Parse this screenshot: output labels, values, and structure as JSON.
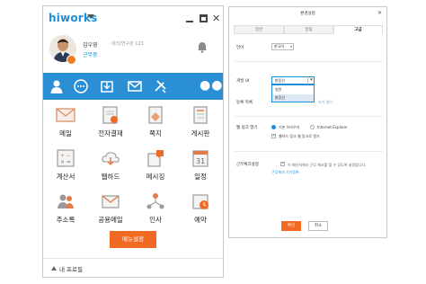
{
  "messenger": {
    "logo": "hiworks",
    "user": {
      "name": "김우영",
      "role": "대리/연구원 123",
      "status": "근무중"
    },
    "apps": [
      {
        "label": "메일",
        "icon": "mail-icon"
      },
      {
        "label": "전자결재",
        "icon": "approval-icon"
      },
      {
        "label": "쪽지",
        "icon": "note-icon"
      },
      {
        "label": "게시판",
        "icon": "board-icon"
      },
      {
        "label": "계산서",
        "icon": "invoice-icon"
      },
      {
        "label": "웹하드",
        "icon": "webhard-icon"
      },
      {
        "label": "메시징",
        "icon": "messaging-icon"
      },
      {
        "label": "일정",
        "icon": "calendar-icon"
      },
      {
        "label": "주소록",
        "icon": "address-book-icon"
      },
      {
        "label": "공용메일",
        "icon": "shared-mail-icon"
      },
      {
        "label": "인사",
        "icon": "hr-icon"
      },
      {
        "label": "예약",
        "icon": "reservation-icon"
      }
    ],
    "calendar_day": "31",
    "menu_settings_button": "메뉴설정",
    "footer_label": "내 프로필",
    "colors": {
      "brand_blue": "#2b8fd6",
      "accent_orange": "#f06a24"
    }
  },
  "settings": {
    "title": "환경설정",
    "tabs": [
      "일반",
      "알림",
      "고급"
    ],
    "active_tab": "고급",
    "language": {
      "label": "언어",
      "value": "한국어"
    },
    "display": {
      "label": "개발 UI",
      "value": "밝음선",
      "options": [
        "일반",
        "밝음선"
      ],
      "selected_option": "밝음선",
      "hint": "보기 열기"
    },
    "status_row_label": "등록 목록",
    "web_link": {
      "label": "웹 링크 열기",
      "option_default": "기본 브라우저",
      "option_ie": "Internet Explorer",
      "option_custom": "웹하드 링크 웹 링크로 열기"
    },
    "work_status": {
      "label": "근무체크설정",
      "note": "이 메신저에서 근무 체크를 할 수 있도록 설정합니다.",
      "link": "근무체크 기기등록"
    },
    "ok_button": "확인",
    "cancel_button": "취소"
  }
}
